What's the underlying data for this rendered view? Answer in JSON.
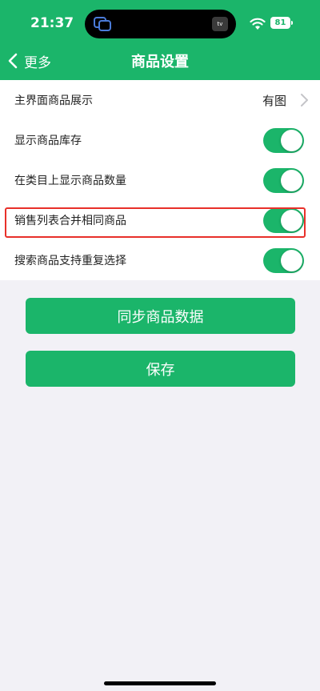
{
  "status": {
    "time": "21:37",
    "battery": "81",
    "island_badge": "tv"
  },
  "header": {
    "back_label": "更多",
    "title": "商品设置"
  },
  "settings": {
    "rows": [
      {
        "label": "主界面商品展示",
        "value": "有图"
      },
      {
        "label": "显示商品库存",
        "toggle": true
      },
      {
        "label": "在类目上显示商品数量",
        "toggle": true
      },
      {
        "label": "销售列表合并相同商品",
        "toggle": true
      },
      {
        "label": "搜索商品支持重复选择",
        "toggle": true
      }
    ]
  },
  "actions": {
    "sync_label": "同步商品数据",
    "save_label": "保存"
  },
  "colors": {
    "accent": "#1bb56a",
    "highlight": "#e8302a",
    "background": "#f2f1f6"
  }
}
